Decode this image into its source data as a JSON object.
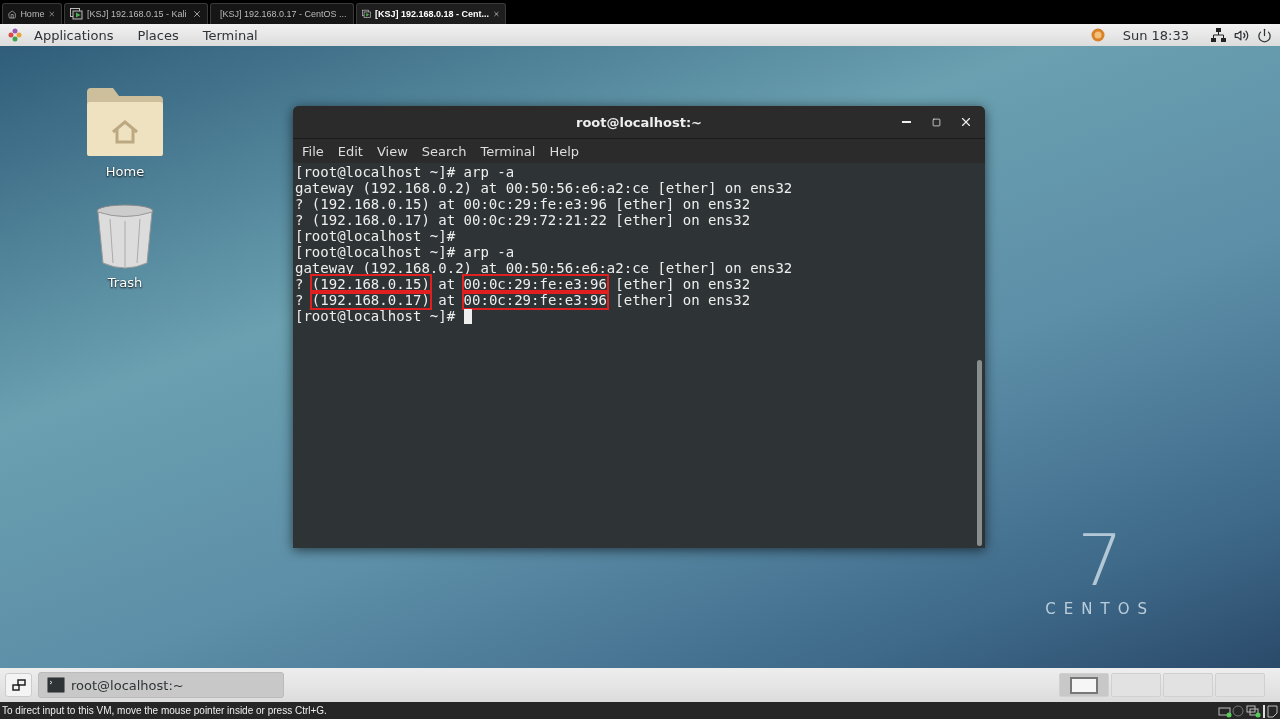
{
  "vm_tabs": [
    {
      "label": "Home",
      "kind": "home",
      "selected": false
    },
    {
      "label": "[KSJ] 192.168.0.15 - Kali",
      "kind": "vm",
      "selected": false
    },
    {
      "label": "[KSJ] 192.168.0.17 - CentOS ...",
      "kind": "vm",
      "selected": false
    },
    {
      "label": "[KSJ] 192.168.0.18 - Cent...",
      "kind": "vm",
      "selected": true
    }
  ],
  "top_panel": {
    "menus": [
      "Applications",
      "Places",
      "Terminal"
    ],
    "clock": "Sun 18:33"
  },
  "desktop_icons": [
    {
      "label": "Home",
      "kind": "folder"
    },
    {
      "label": "Trash",
      "kind": "trash"
    }
  ],
  "logo": {
    "number": "7",
    "name": "CENTOS"
  },
  "terminal": {
    "title": "root@localhost:~",
    "menu": [
      "File",
      "Edit",
      "View",
      "Search",
      "Terminal",
      "Help"
    ],
    "lines": [
      {
        "cursor": false,
        "segments": [
          {
            "text": "[root@localhost ~]# arp -a",
            "highlighted": false
          }
        ]
      },
      {
        "cursor": false,
        "segments": [
          {
            "text": "gateway (192.168.0.2) at 00:50:56:e6:a2:ce [ether] on ens32",
            "highlighted": false
          }
        ]
      },
      {
        "cursor": false,
        "segments": [
          {
            "text": "? (192.168.0.15) at 00:0c:29:fe:e3:96 [ether] on ens32",
            "highlighted": false
          }
        ]
      },
      {
        "cursor": false,
        "segments": [
          {
            "text": "? (192.168.0.17) at 00:0c:29:72:21:22 [ether] on ens32",
            "highlighted": false
          }
        ]
      },
      {
        "cursor": false,
        "segments": [
          {
            "text": "[root@localhost ~]#",
            "highlighted": false
          }
        ]
      },
      {
        "cursor": false,
        "segments": [
          {
            "text": "[root@localhost ~]# arp -a",
            "highlighted": false
          }
        ]
      },
      {
        "cursor": false,
        "segments": [
          {
            "text": "gateway (192.168.0.2) at 00:50:56:e6:a2:ce [ether] on ens32",
            "highlighted": false
          }
        ]
      },
      {
        "cursor": false,
        "segments": [
          {
            "text": "? ",
            "highlighted": false
          },
          {
            "text": "(192.168.0.15)",
            "highlighted": true
          },
          {
            "text": " at ",
            "highlighted": false
          },
          {
            "text": "00:0c:29:fe:e3:96",
            "highlighted": true
          },
          {
            "text": " [ether] on ens32",
            "highlighted": false
          }
        ]
      },
      {
        "cursor": false,
        "segments": [
          {
            "text": "? ",
            "highlighted": false
          },
          {
            "text": "(192.168.0.17)",
            "highlighted": true
          },
          {
            "text": " at ",
            "highlighted": false
          },
          {
            "text": "00:0c:29:fe:e3:96",
            "highlighted": true
          },
          {
            "text": " [ether] on ens32",
            "highlighted": false
          }
        ]
      },
      {
        "cursor": true,
        "segments": [
          {
            "text": "[root@localhost ~]# ",
            "highlighted": false
          }
        ]
      }
    ]
  },
  "taskbar": {
    "window_button": "root@localhost:~",
    "workspaces": [
      {
        "selected": true
      },
      {
        "selected": false
      },
      {
        "selected": false
      },
      {
        "selected": false
      }
    ]
  },
  "status_bar": {
    "message": "To direct input to this VM, move the mouse pointer inside or press Ctrl+G."
  }
}
